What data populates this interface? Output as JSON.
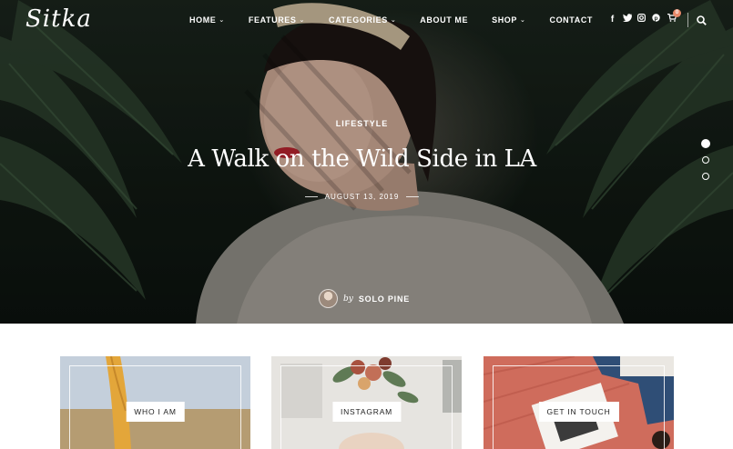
{
  "brand": {
    "logo": "Sitka"
  },
  "nav": {
    "items": [
      {
        "label": "HOME",
        "has_dropdown": true
      },
      {
        "label": "FEATURES",
        "has_dropdown": true
      },
      {
        "label": "CATEGORIES",
        "has_dropdown": true
      },
      {
        "label": "ABOUT ME",
        "has_dropdown": false
      },
      {
        "label": "SHOP",
        "has_dropdown": true
      },
      {
        "label": "CONTACT",
        "has_dropdown": false
      }
    ],
    "social_icons": [
      "facebook-icon",
      "twitter-icon",
      "instagram-icon",
      "pinterest-icon"
    ],
    "cart_count": "0"
  },
  "hero": {
    "category": "LIFESTYLE",
    "title": "A Walk on the Wild Side in LA",
    "date": "AUGUST 13, 2019",
    "by_label": "by",
    "author": "SOLO PINE",
    "slides": 3,
    "active_slide": 1
  },
  "promo": {
    "cards": [
      {
        "label": "WHO I AM"
      },
      {
        "label": "INSTAGRAM"
      },
      {
        "label": "GET IN TOUCH"
      }
    ]
  },
  "colors": {
    "accent": "#e88a6a",
    "text_light": "#ffffff",
    "dark": "#222222"
  }
}
